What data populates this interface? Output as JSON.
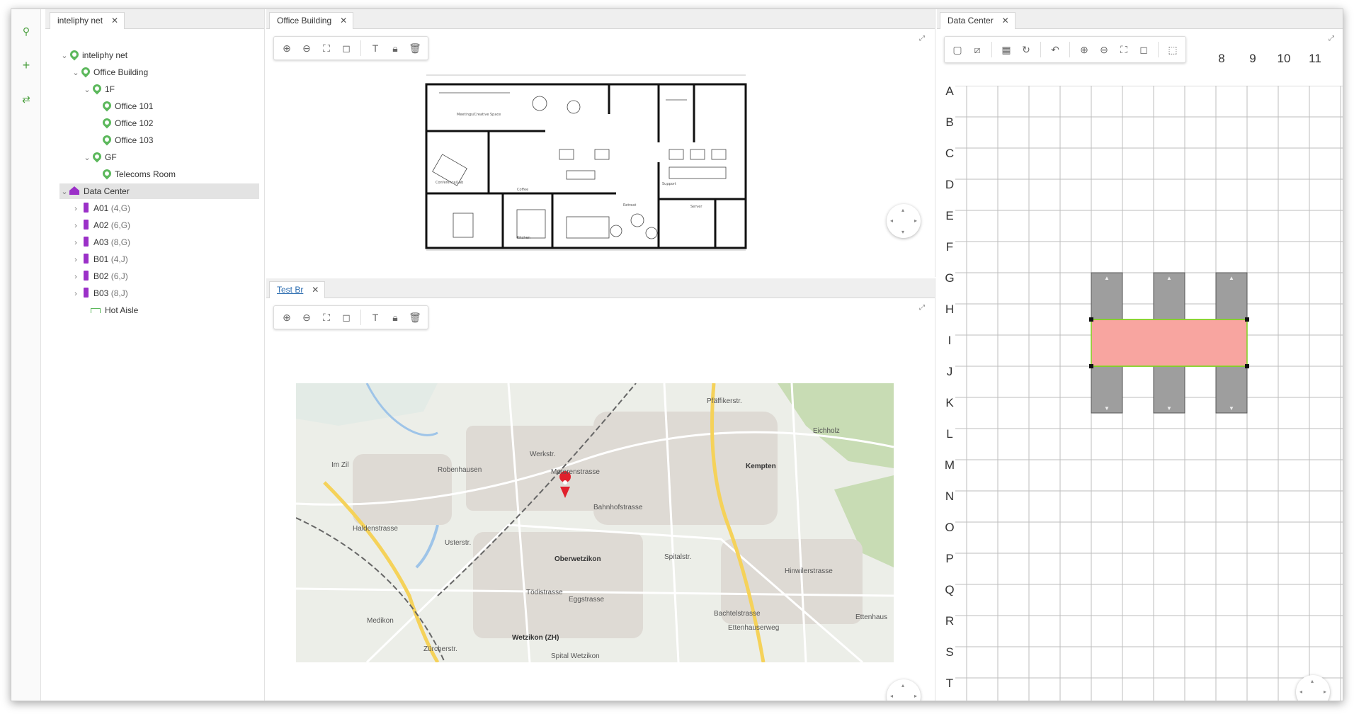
{
  "tree_panel": {
    "tab_title": "inteliphy net",
    "nodes": [
      {
        "label": "inteliphy net",
        "suffix": ""
      },
      {
        "label": "Office Building",
        "suffix": ""
      },
      {
        "label": "1F",
        "suffix": ""
      },
      {
        "label": "Office 101",
        "suffix": ""
      },
      {
        "label": "Office 102",
        "suffix": ""
      },
      {
        "label": "Office 103",
        "suffix": ""
      },
      {
        "label": "GF",
        "suffix": ""
      },
      {
        "label": "Telecoms Room",
        "suffix": ""
      },
      {
        "label": "Data Center",
        "suffix": ""
      },
      {
        "label": "A01",
        "suffix": "(4,G)"
      },
      {
        "label": "A02",
        "suffix": "(6,G)"
      },
      {
        "label": "A03",
        "suffix": "(8,G)"
      },
      {
        "label": "B01",
        "suffix": "(4,J)"
      },
      {
        "label": "B02",
        "suffix": "(6,J)"
      },
      {
        "label": "B03",
        "suffix": "(8,J)"
      },
      {
        "label": "Hot Aisle",
        "suffix": ""
      }
    ]
  },
  "office_pane": {
    "tab_title": "Office Building",
    "rooms": [
      "Meetings/Creative Space",
      "Conference/Lab",
      "Coffee",
      "Kitchen",
      "Retreat",
      "Support",
      "Server"
    ]
  },
  "map_pane": {
    "tab_title": "Test Br",
    "places": [
      "Robenhausen",
      "Werkstr.",
      "Motorenstrasse",
      "Kempten",
      "Eichholz",
      "Oberwetzikon",
      "Wetzikon (ZH)",
      "Medikon",
      "Ettenhauserweg",
      "Ettenhaus",
      "Spital Wetzikon",
      "Im Zil",
      "Halden­strasse",
      "Usterstr.",
      "Bahnhofstrasse",
      "Tödistrasse",
      "Eggstrasse",
      "Spitalstr.",
      "Hinwilerstrasse",
      "Bachtelstrasse",
      "Pfäffikerstr.",
      "Zürcherstr."
    ]
  },
  "dc_pane": {
    "tab_title": "Data Center",
    "col_labels": [
      "8",
      "9",
      "10",
      "11"
    ],
    "row_labels": [
      "A",
      "B",
      "C",
      "D",
      "E",
      "F",
      "G",
      "H",
      "I",
      "J",
      "K",
      "L",
      "M",
      "N",
      "O",
      "P",
      "Q",
      "R",
      "S",
      "T"
    ],
    "colors": {
      "rack": "#9e9e9e",
      "hot_aisle": "#f8a5a0",
      "aisle_border": "#7ed321"
    }
  }
}
